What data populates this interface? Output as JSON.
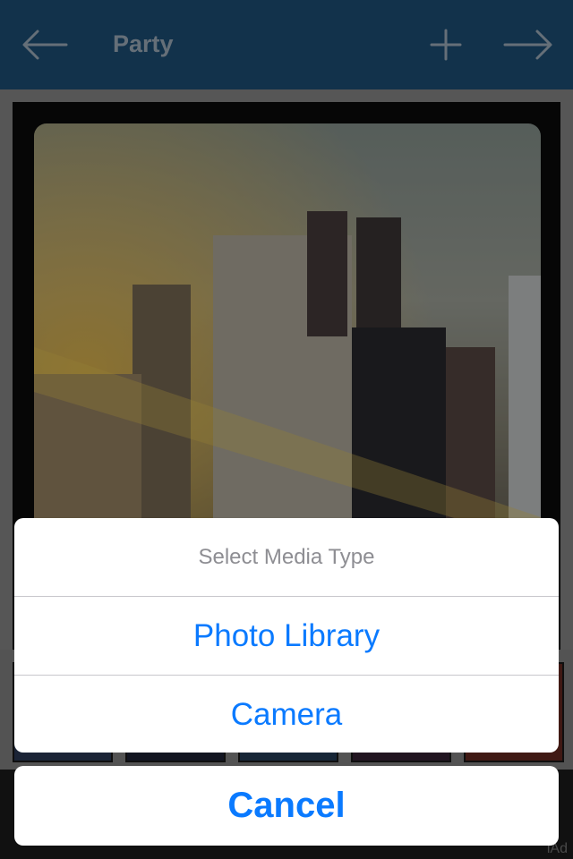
{
  "nav": {
    "title": "Party",
    "back_icon": "arrow-left-icon",
    "add_icon": "plus-icon",
    "next_icon": "arrow-right-icon"
  },
  "action_sheet": {
    "title": "Select Media Type",
    "options": [
      "Photo Library",
      "Camera"
    ],
    "cancel_label": "Cancel"
  },
  "ad": {
    "label": "iAd"
  },
  "colors": {
    "nav_background": "#1e547e",
    "nav_icon": "#a9b9c8",
    "action_tint": "#0a7aff",
    "sheet_title": "#8e8e93"
  }
}
